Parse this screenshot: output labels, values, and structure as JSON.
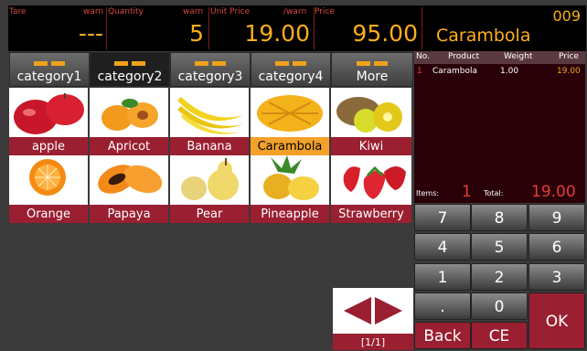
{
  "display": {
    "tare_label": "Tare",
    "tare_warn": "warn",
    "tare_value": "---",
    "quantity_label": "Quantity",
    "quantity_warn": "warn",
    "quantity_value": "5",
    "unit_price_label": "Unit Price",
    "unit_price_warn": "/warn",
    "unit_price_value": "19.00",
    "price_label": "Price",
    "price_value": "95.00",
    "receipt_no": "009",
    "current_product": "Carambola"
  },
  "categories": [
    {
      "label": "category1",
      "active": false
    },
    {
      "label": "category2",
      "active": true
    },
    {
      "label": "category3",
      "active": false
    },
    {
      "label": "category4",
      "active": false
    },
    {
      "label": "More",
      "active": false
    }
  ],
  "products": [
    {
      "label": "apple"
    },
    {
      "label": "Apricot"
    },
    {
      "label": "Banana"
    },
    {
      "label": "Carambola",
      "selected": true
    },
    {
      "label": "Kiwi"
    },
    {
      "label": "Orange"
    },
    {
      "label": "Papaya"
    },
    {
      "label": "Pear"
    },
    {
      "label": "Pineapple"
    },
    {
      "label": "Strawberry"
    }
  ],
  "pager": {
    "label": "[1/1]"
  },
  "receipt": {
    "headers": {
      "no": "No.",
      "product": "Product",
      "weight": "Weight",
      "price": "Price"
    },
    "items": [
      {
        "no": "1",
        "product": "Carambola",
        "weight": "1.00",
        "price": "19.00"
      }
    ],
    "items_label": "Items:",
    "items_count": "1",
    "total_label": "Total:",
    "total_value": "19.00"
  },
  "keypad": {
    "k7": "7",
    "k8": "8",
    "k9": "9",
    "k4": "4",
    "k5": "5",
    "k6": "6",
    "k1": "1",
    "k2": "2",
    "k3": "3",
    "kdot": ".",
    "k0": "0",
    "back": "Back",
    "ce": "CE",
    "ok": "OK"
  },
  "colors": {
    "accent": "#ffae1a",
    "brand": "#9a1f31",
    "selected": "#f3a12a"
  }
}
